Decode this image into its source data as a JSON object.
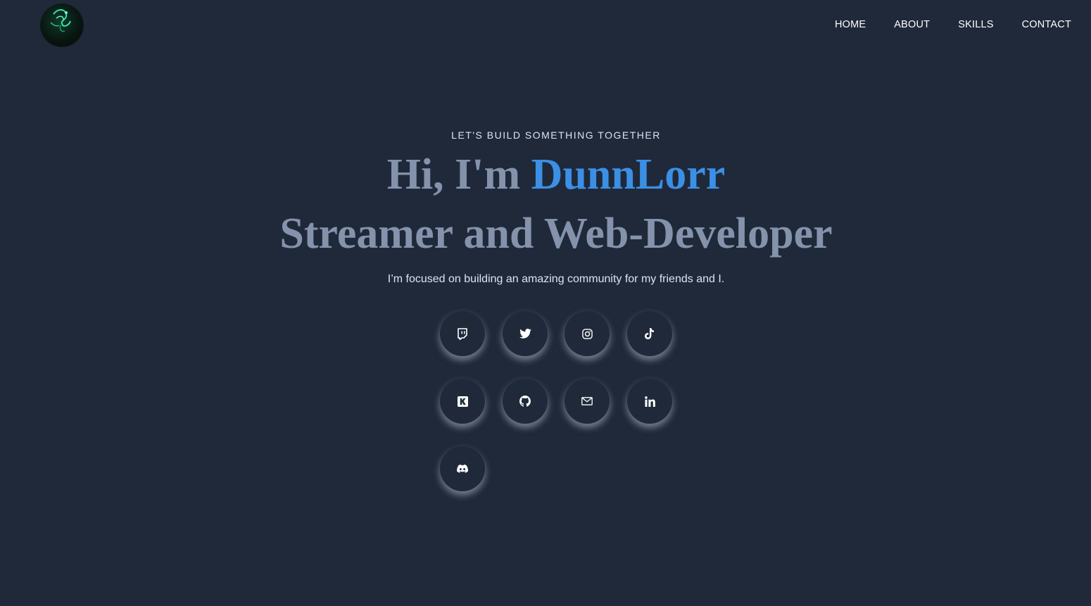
{
  "header": {
    "logo_icon": "neon-green-emblem-logo",
    "nav": [
      {
        "label": "HOME"
      },
      {
        "label": "ABOUT"
      },
      {
        "label": "SKILLS"
      },
      {
        "label": "CONTACT"
      }
    ]
  },
  "hero": {
    "tagline": "LET'S BUILD SOMETHING TOGETHER",
    "greeting": "Hi, I'm ",
    "name": "DunnLorr",
    "subtitle": "Streamer and Web-Developer",
    "description": "I’m focused on building an amazing community for my friends and I."
  },
  "socials": [
    {
      "icon": "twitch-icon"
    },
    {
      "icon": "twitter-icon"
    },
    {
      "icon": "instagram-icon"
    },
    {
      "icon": "tiktok-icon"
    },
    {
      "icon": "kick-icon"
    },
    {
      "icon": "github-icon"
    },
    {
      "icon": "email-icon"
    },
    {
      "icon": "linkedin-icon"
    },
    {
      "icon": "discord-icon"
    }
  ],
  "colors": {
    "background": "#1f293a",
    "accent": "#3b8fe4",
    "heading": "#8493ab",
    "text": "#dce4f0"
  }
}
